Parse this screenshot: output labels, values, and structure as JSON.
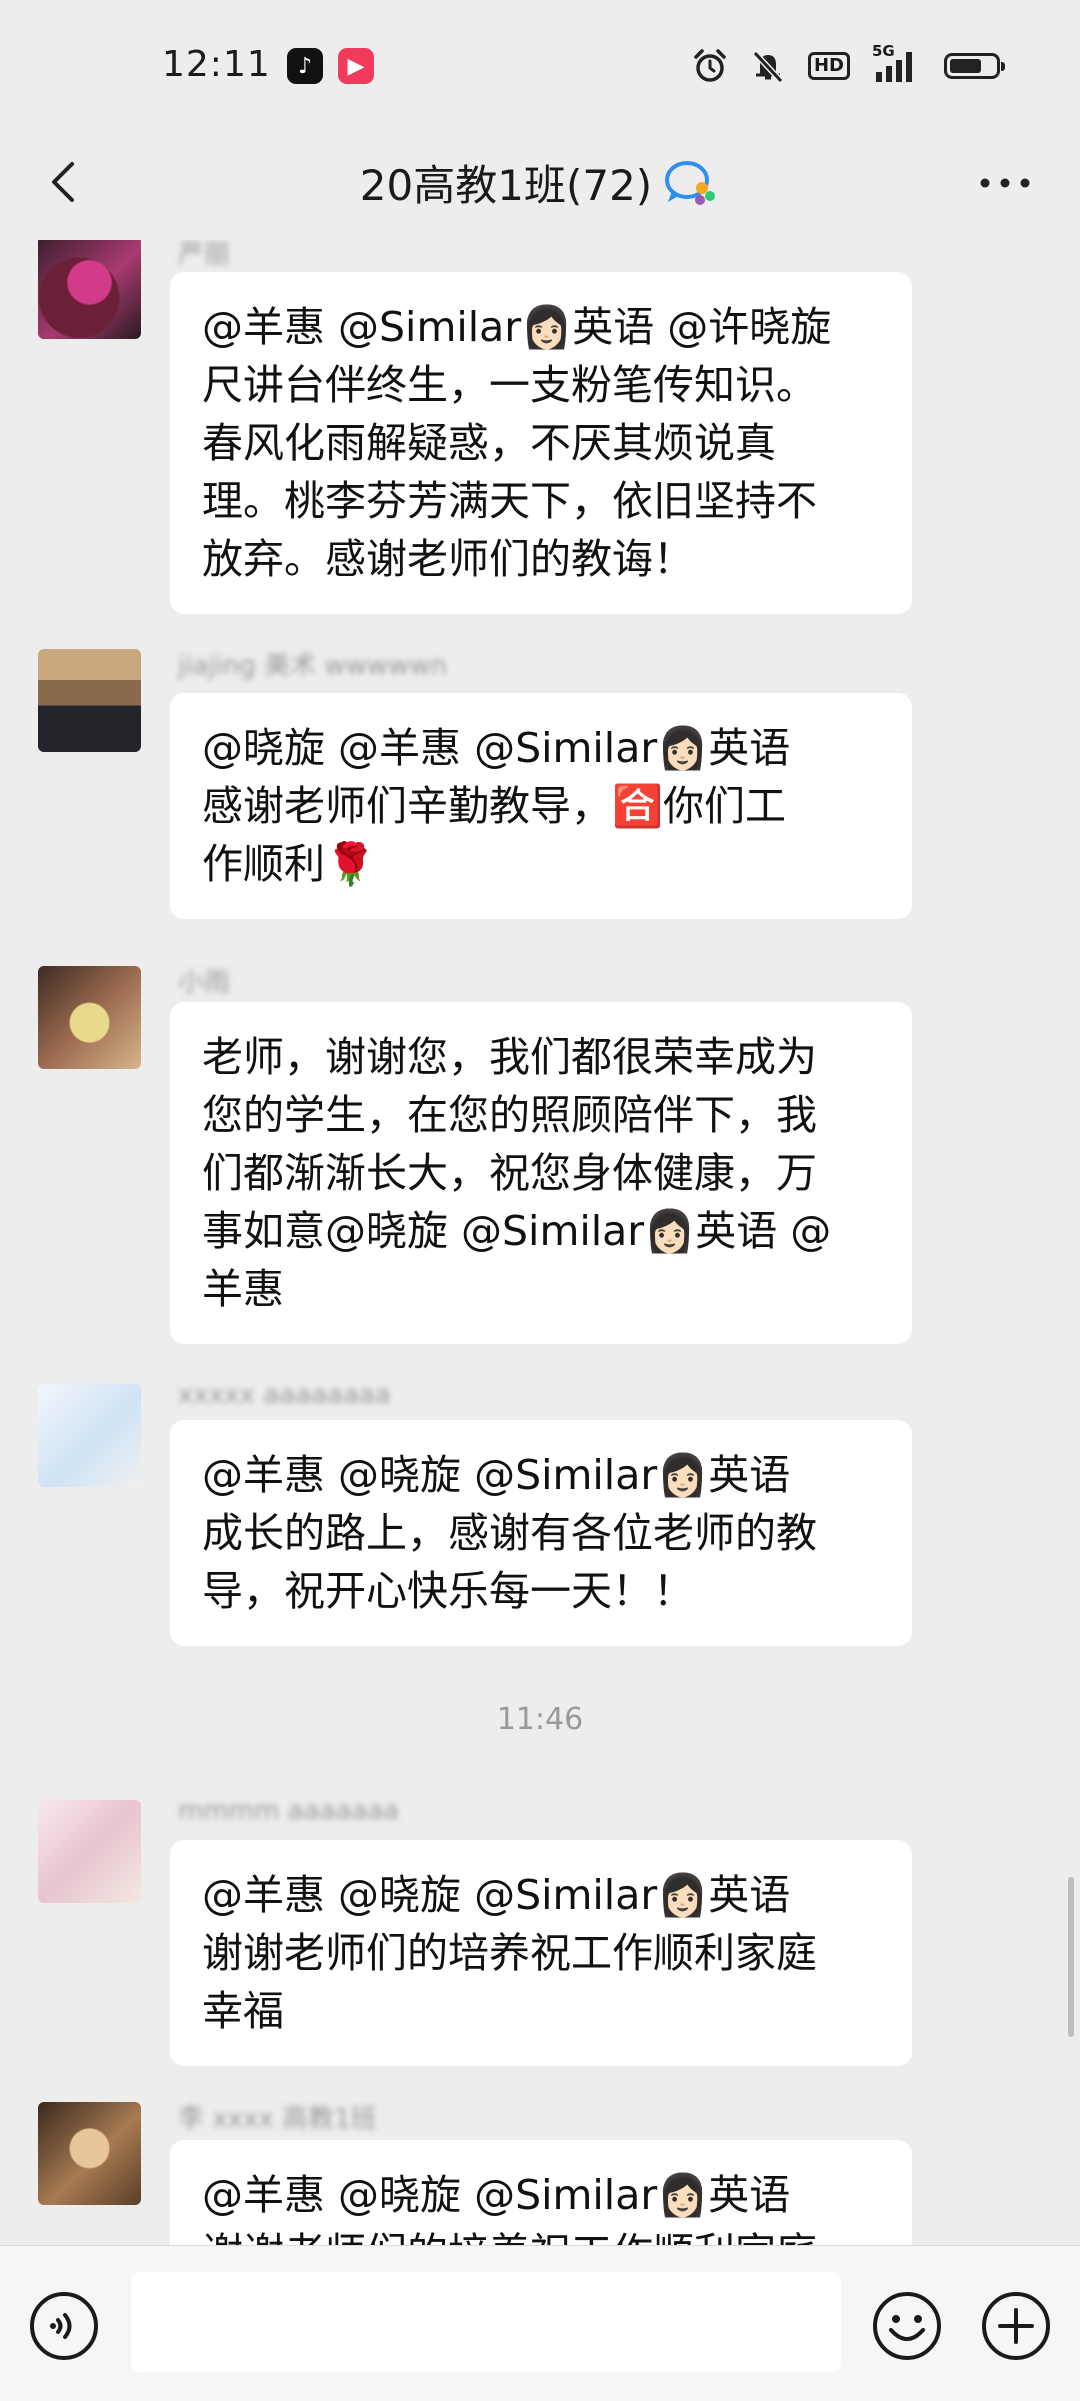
{
  "status": {
    "time": "12:11",
    "tiktok_glyph": "♪",
    "video_glyph": "▶",
    "hd_label": "HD",
    "net_label": "5G",
    "battery_fraction": 0.7
  },
  "header": {
    "title": "20高教1班(72)",
    "back_icon": "chevron-left-icon",
    "more_icon": "ellipsis-icon",
    "group_icon": "group-chat-icon"
  },
  "messages": [
    {
      "nick": "严丽",
      "lines": [
        "@羊惠  @Similar👩🏻英语  @许晓旋",
        "尺讲台伴终生，一支粉笔传知识。",
        "春风化雨解疑惑，不厌其烦说真",
        "理。桃李芬芳满天下，依旧坚持不",
        "放弃。感谢老师们的教诲！"
      ]
    },
    {
      "nick": "jiajing 美术 wwwwwn",
      "lines": [
        "@晓旋 @羊惠 @Similar👩🏻英语",
        "感谢老师们辛勤教导，🈴你们工",
        "作顺利🌹"
      ]
    },
    {
      "nick": "小雨",
      "lines": [
        "老师，谢谢您，我们都很荣幸成为",
        "您的学生，在您的照顾陪伴下，我",
        "们都渐渐长大，祝您身体健康，万",
        "事如意@晓旋  @Similar👩🏻英语  @",
        "羊惠"
      ]
    },
    {
      "nick": "xxxxx aaaaaaaa",
      "lines": [
        "@羊惠  @晓旋  @Similar👩🏻英语",
        "成长的路上，感谢有各位老师的教",
        "导，祝开心快乐每一天！！"
      ]
    },
    {
      "nick": "mmmm aaaaaaa",
      "lines": [
        "@羊惠  @晓旋  @Similar👩🏻英语",
        "谢谢老师们的培养祝工作顺利家庭",
        "幸福"
      ]
    },
    {
      "nick": "李 xxxx 高教1班",
      "lines": [
        "@羊惠  @晓旋  @Similar👩🏻英语",
        "谢谢老师们的培养祝工作顺利家庭"
      ]
    }
  ],
  "timestamp": "11:46",
  "input": {
    "placeholder": "",
    "voice_icon": "voice-icon",
    "emoji_icon": "emoji-icon",
    "plus_icon": "plus-icon"
  },
  "colors": {
    "background": "#ededed",
    "bubble": "#ffffff",
    "timestamp": "#9a9a9a"
  }
}
